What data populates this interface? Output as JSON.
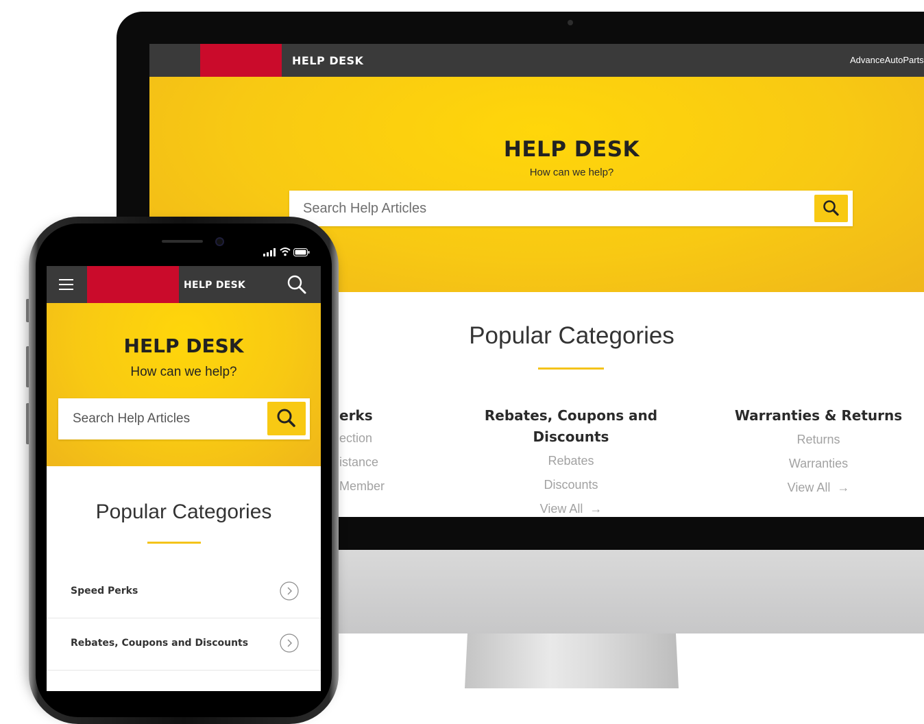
{
  "desktop": {
    "nav": {
      "title": "HELP DESK",
      "account_link": "AdvanceAutoParts"
    },
    "hero": {
      "title": "HELP DESK",
      "subtitle": "How can we help?",
      "search_placeholder": "Search Help Articles"
    },
    "popular": {
      "heading": "Popular Categories",
      "columns": [
        {
          "title": "erks",
          "links": [
            "ection",
            "istance",
            "Member"
          ]
        },
        {
          "title": "Rebates, Coupons and Discounts",
          "links": [
            "Rebates",
            "Discounts"
          ],
          "view_all": "View All"
        },
        {
          "title": "Warranties & Returns",
          "links": [
            "Returns",
            "Warranties"
          ],
          "view_all": "View All"
        }
      ],
      "arrow": "→"
    }
  },
  "mobile": {
    "status": {
      "signal": "signal-icon",
      "wifi": "wifi-icon",
      "battery": "battery-icon"
    },
    "nav": {
      "title": "HELP DESK"
    },
    "hero": {
      "title": "HELP DESK",
      "subtitle": "How can we help?",
      "search_placeholder": "Search Help Articles"
    },
    "popular": {
      "heading": "Popular Categories",
      "items": [
        {
          "label": "Speed Perks"
        },
        {
          "label": "Rebates, Coupons and Discounts"
        }
      ]
    }
  },
  "colors": {
    "brand_red": "#ca0b2b",
    "brand_yellow": "#f8c913",
    "nav_dark": "#3a3a3a",
    "link_gray": "#a2a2a2"
  }
}
